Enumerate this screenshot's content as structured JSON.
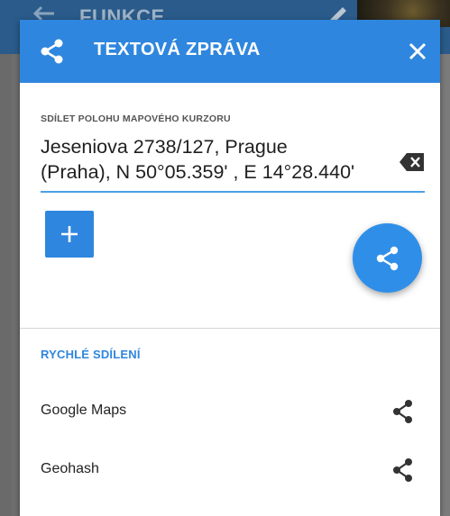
{
  "background": {
    "title": "FUNKCE"
  },
  "dialog": {
    "title": "TEXTOVÁ ZPRÁVA",
    "field": {
      "label": "SDÍLET POLOHU MAPOVÉHO KURZORU",
      "line1": "Jeseniova 2738/127, Prague",
      "line2": "(Praha), N 50°05.359' , E 14°28.440'"
    },
    "quick_share": {
      "title": "RYCHLÉ SDÍLENÍ",
      "items": [
        {
          "label": "Google Maps",
          "icon": "share-icon"
        },
        {
          "label": "Geohash",
          "icon": "share-icon"
        }
      ]
    }
  },
  "colors": {
    "accent": "#2f86de",
    "header": "#2f86de",
    "underline": "#4aa0e6",
    "text": "#1f1f1f",
    "icon_dark": "#333333"
  }
}
